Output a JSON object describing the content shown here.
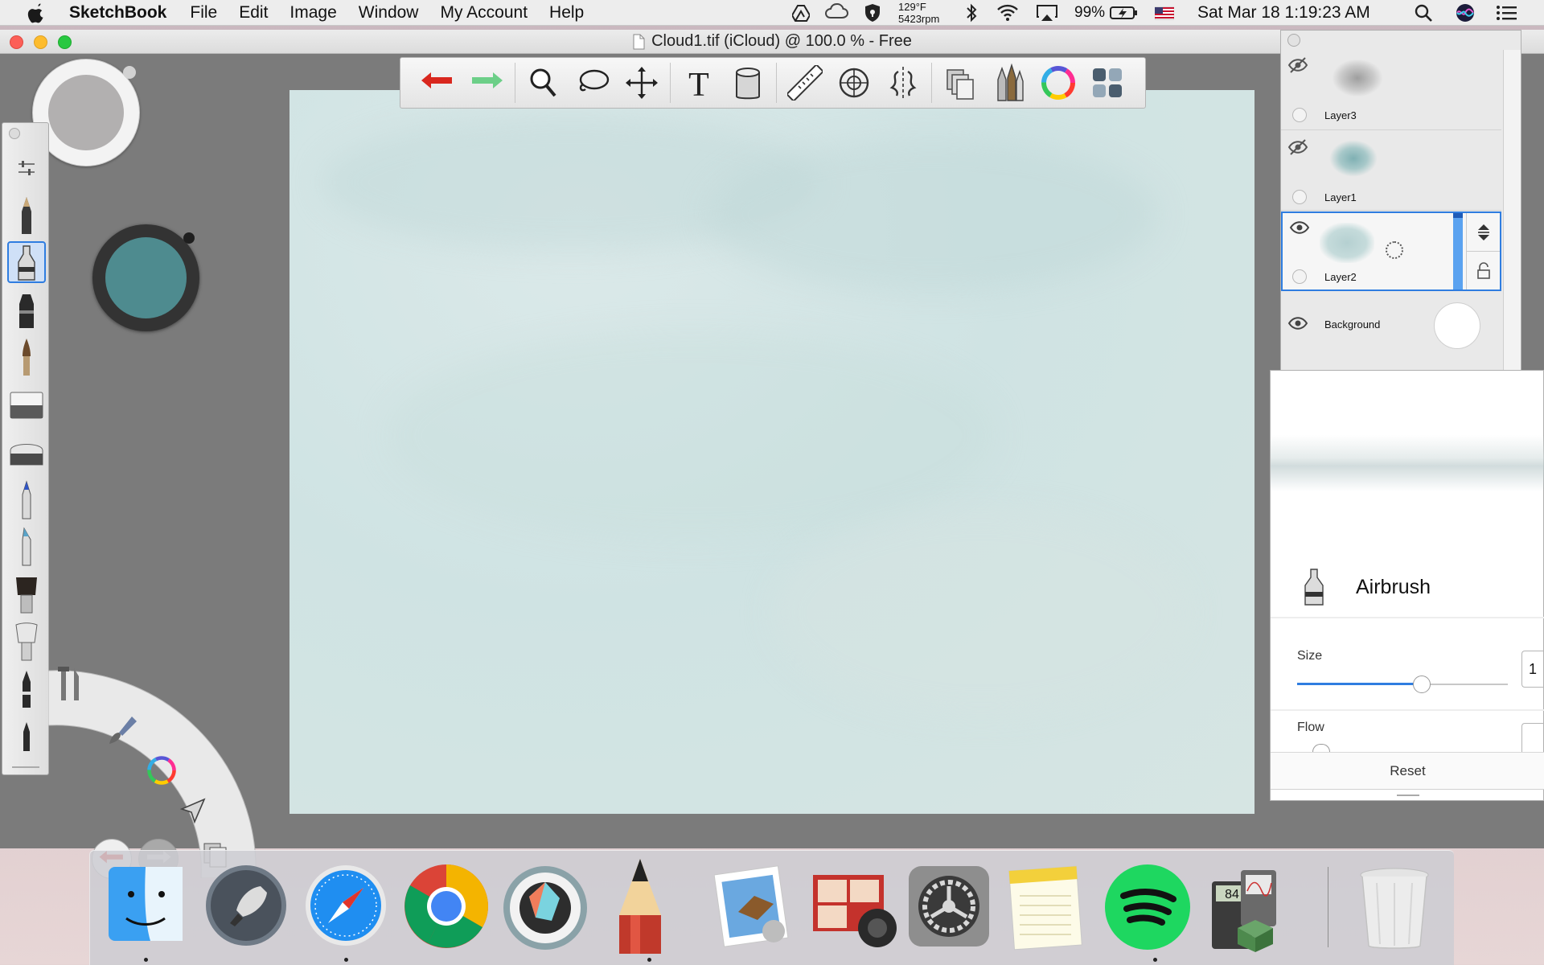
{
  "menubar": {
    "app_name": "SketchBook",
    "menus": [
      "File",
      "Edit",
      "Image",
      "Window",
      "My Account",
      "Help"
    ],
    "temperature": "129°F",
    "fan_speed": "5423rpm",
    "battery": "99%",
    "datetime": "Sat Mar 18  1:19:23 AM"
  },
  "window": {
    "title": "Cloud1.tif (iCloud) @ 100.0 % - Free"
  },
  "layers": [
    {
      "label": "Layer3",
      "visible": false,
      "selected": false
    },
    {
      "label": "Layer1",
      "visible": false,
      "selected": false
    },
    {
      "label": "Layer2",
      "visible": true,
      "selected": true
    },
    {
      "label": "Background",
      "visible": true,
      "selected": false
    }
  ],
  "brush_panel": {
    "brush_name": "Airbrush",
    "size_label": "Size",
    "size_value": "1",
    "size_slider_fraction": 0.59,
    "flow_label": "Flow",
    "reset_label": "Reset"
  },
  "colors": {
    "current_color": "#4e8b8f",
    "accent_blue": "#2f7de0",
    "undo_red": "#d9271e",
    "redo_green": "#6ccf88"
  },
  "dock": {
    "apps": [
      "Finder",
      "Launchpad",
      "Safari",
      "Google Chrome",
      "Pixelmator",
      "SketchBook",
      "Mail",
      "Photo Booth",
      "System Preferences",
      "Notes",
      "Spotify",
      "Graphing Calculator",
      "Trash"
    ]
  }
}
